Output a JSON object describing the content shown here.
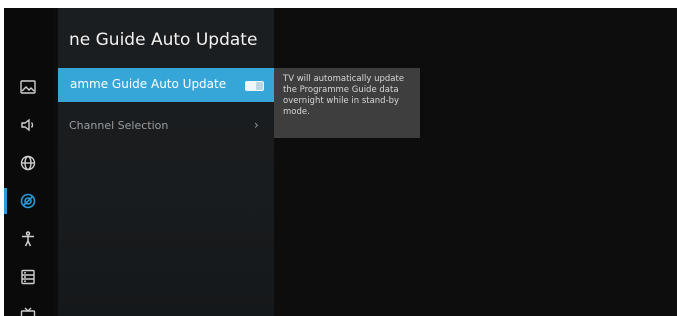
{
  "panel": {
    "title": "ne Guide Auto Update"
  },
  "menu": {
    "items": [
      {
        "label": "amme Guide Auto Update",
        "toggle": "on",
        "selected": true
      },
      {
        "label": "Channel Selection",
        "chevron": "›",
        "selected": false
      }
    ]
  },
  "tooltip": {
    "text": "TV will automatically update the Programme Guide data overnight while in stand-by mode."
  },
  "sidebar": {
    "icons": [
      "picture-icon",
      "sound-icon",
      "network-icon",
      "channel-icon",
      "accessibility-icon",
      "system-icon",
      "tv-icon"
    ],
    "active": "channel-icon"
  },
  "colors": {
    "accent": "#36a6d8",
    "sidebar_active": "#2a9bd8",
    "background": "#0d0d0d"
  }
}
